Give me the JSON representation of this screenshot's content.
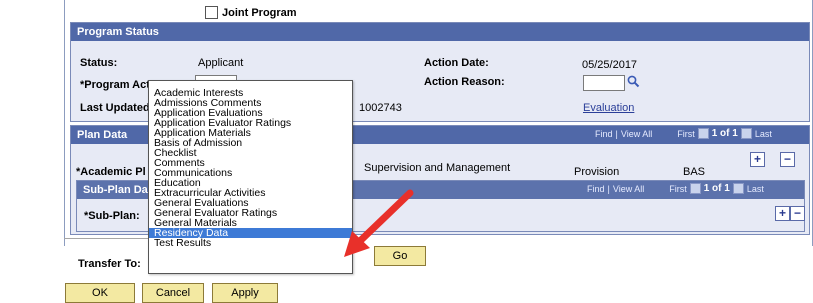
{
  "joint_program": {
    "label": "Joint Program"
  },
  "program_status": {
    "title": "Program Status",
    "status_label": "Status:",
    "status_value": "Applicant",
    "program_action_label": "*Program Act",
    "last_updated_label": "Last Updated",
    "action_date_label": "Action Date:",
    "action_date_value": "05/25/2017",
    "action_reason_label": "Action Reason:",
    "updated_id": "1002743",
    "evaluation_link": "Evaluation"
  },
  "plan_data": {
    "title": "Plan Data",
    "find_label": "Find",
    "view_all_label": "View All",
    "first_label": "First",
    "count": "1 of 1",
    "last_label": "Last",
    "academic_plan_label": "*Academic Pl",
    "plan_description": "Supervision and Management",
    "provision": "Provision",
    "degree": "BAS",
    "add_symbol": "+",
    "remove_symbol": "−"
  },
  "sub_plan": {
    "title": "Sub-Plan Da",
    "find_label": "Find",
    "view_all_label": "View All",
    "first_label": "First",
    "count": "1 of 1",
    "last_label": "Last",
    "label": "*Sub-Plan:"
  },
  "transfer": {
    "label": "Transfer To:",
    "go_label": "Go"
  },
  "buttons": {
    "ok": "OK",
    "cancel": "Cancel",
    "apply": "Apply"
  },
  "dropdown": {
    "selected": "Residency Data",
    "options": [
      "Academic Interests",
      "Admissions Comments",
      "Application Evaluations",
      "Application Evaluator Ratings",
      "Application Materials",
      "Basis of Admission",
      "Checklist",
      "Comments",
      "Communications",
      "Education",
      "Extracurricular Activities",
      "General Evaluations",
      "General Evaluator Ratings",
      "General Materials",
      "Residency Data",
      "Test Results"
    ]
  },
  "annotation": {
    "arrow_color": "#e8302a",
    "arrow_icon": "red-arrow-icon"
  },
  "colors": {
    "header": "#5068a8",
    "panel": "#e7eaf5",
    "selection": "#3d7ad6",
    "button": "#f3e9a2"
  }
}
